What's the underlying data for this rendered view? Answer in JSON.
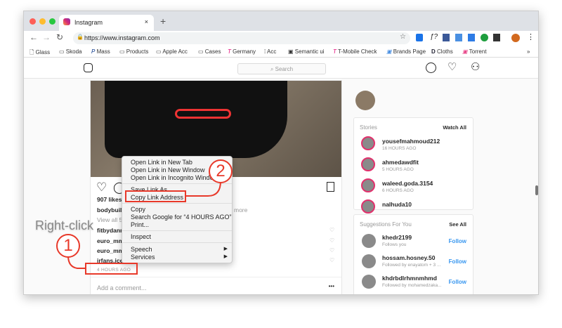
{
  "browser": {
    "tab_title": "Instagram",
    "url": "https://www.instagram.com",
    "bookmarks": [
      "Glass",
      "Skoda",
      "Mass",
      "Products",
      "Apple Acc",
      "Cases",
      "Germany",
      "Acc",
      "Semantic ui",
      "T-Mobile Check",
      "Brands Page",
      "Cloths",
      "Torrent"
    ],
    "more": "»"
  },
  "instagram": {
    "search_placeholder": "Search"
  },
  "post": {
    "likes": "907 likes",
    "caption_user": "bodybuil",
    "more": "more",
    "view_all": "View all 5",
    "comments": [
      "fitbydann",
      "euro_mm",
      "euro_mm",
      "irfans.ice"
    ],
    "time": "4 HOURS AGO",
    "add_comment": "Add a comment...",
    "options": "•••"
  },
  "stories": {
    "title": "Stories",
    "watch_all": "Watch All",
    "items": [
      {
        "name": "yousefmahmoud212",
        "time": "16 HOURS AGO"
      },
      {
        "name": "ahmedawdfit",
        "time": "5 HOURS AGO"
      },
      {
        "name": "waleed.goda.3154",
        "time": "6 HOURS AGO"
      },
      {
        "name": "nalhuda10",
        "time": ""
      }
    ]
  },
  "suggestions": {
    "title": "Suggestions For You",
    "see_all": "See All",
    "follow": "Follow",
    "items": [
      {
        "name": "khedr2199",
        "sub": "Follows you"
      },
      {
        "name": "hossam.hosney.50",
        "sub": "Followed by enayatom + 3 ..."
      },
      {
        "name": "khdrbdlrhmnmhmd",
        "sub": "Followed by mohamedzaka..."
      }
    ]
  },
  "context_menu": {
    "items": [
      "Open Link in New Tab",
      "Open Link in New Window",
      "Open Link in Incognito Window",
      "Save Link As...",
      "Copy Link Address",
      "Copy",
      "Search Google for “4 HOURS AGO”",
      "Print...",
      "Inspect",
      "Speech",
      "Services"
    ]
  },
  "annotations": {
    "right_click": "Right-click",
    "step1": "1",
    "step2": "2"
  }
}
